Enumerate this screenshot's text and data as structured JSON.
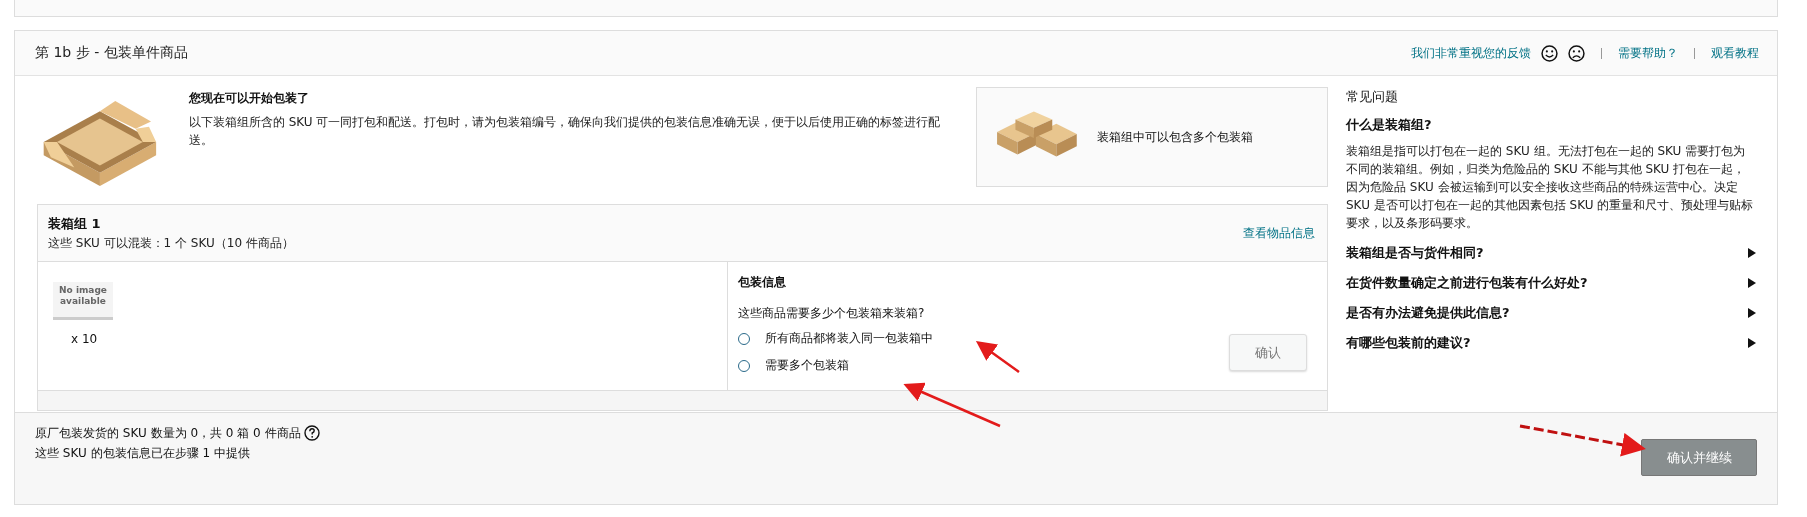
{
  "step": {
    "title": "第 1b 步 - 包装单件商品",
    "links": [
      {
        "kind": "feedback",
        "label": "我们非常重视您的反馈"
      },
      {
        "kind": "link",
        "label": "需要帮助？"
      },
      {
        "kind": "link",
        "label": "观看教程"
      }
    ]
  },
  "intro": {
    "heading": "您现在可以开始包装了",
    "text": "以下装箱组所含的 SKU 可一同打包和配送。打包时，请为包装箱编号，确保向我们提供的包装信息准确无误，便于以后使用正确的标签进行配送。",
    "tip": "装箱组中可以包含多个包装箱"
  },
  "pack_group": {
    "title": "装箱组 1",
    "subtitle": "这些 SKU 可以混装：1 个 SKU（10 件商品）",
    "link": "查看物品信息",
    "item": {
      "image_text": "No image available",
      "quantity": "x 10"
    },
    "packing_info": {
      "title": "包装信息",
      "question": "这些商品需要多少个包装箱来装箱?",
      "options": [
        {
          "label": "所有商品都将装入同一包装箱中",
          "selected": false
        },
        {
          "label": "需要多个包装箱",
          "selected": false
        }
      ],
      "button": {
        "label": "确认",
        "disabled": true
      }
    }
  },
  "footer": {
    "summary": "原厂包装发货的 SKU 数量为 0，共 0 箱 0 件商品",
    "note": "这些 SKU 的包装信息已在步骤 1 中提供",
    "button": {
      "label": "确认并继续",
      "disabled": true
    }
  },
  "faq": {
    "title": "常见问题",
    "items": [
      {
        "question": "什么是装箱组?",
        "expanded": true,
        "answer": "装箱组是指可以打包在一起的 SKU 组。无法打包在一起的 SKU 需要打包为不同的装箱组。例如，归类为危险品的 SKU 不能与其他 SKU 打包在一起，因为危险品 SKU 会被运输到可以安全接收这些商品的特殊运营中心。决定 SKU 是否可以打包在一起的其他因素包括 SKU 的重量和尺寸、预处理与贴标要求，以及条形码要求。"
      },
      {
        "question": "装箱组是否与货件相同?",
        "expanded": false
      },
      {
        "question": "在货件数量确定之前进行包装有什么好处?",
        "expanded": false
      },
      {
        "question": "是否有办法避免提供此信息?",
        "expanded": false
      },
      {
        "question": "有哪些包装前的建议?",
        "expanded": false
      }
    ]
  }
}
